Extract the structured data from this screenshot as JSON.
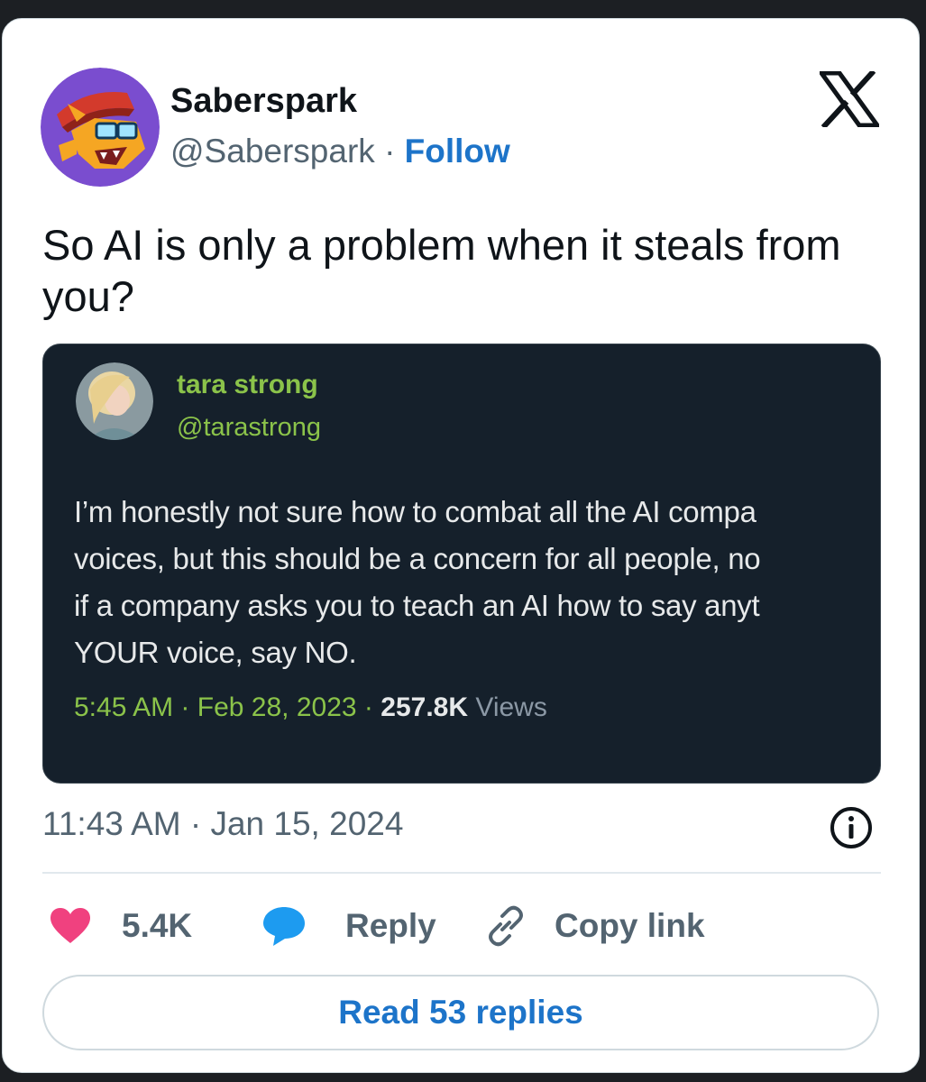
{
  "tweet": {
    "author_name": "Saberspark",
    "author_handle": "@Saberspark",
    "separator": "·",
    "follow_label": "Follow",
    "text": "So AI is only a problem when it steals from you?",
    "timestamp": "11:43 AM · Jan 15, 2024"
  },
  "quoted": {
    "name": "tara strong",
    "handle": "@tarastrong",
    "lines": [
      "I’m honestly not sure how to combat all the AI compa",
      "voices, but this should be a concern for all people, no",
      "if a company asks you to teach an AI how to say anyt",
      "YOUR voice, say NO."
    ],
    "time": "5:45 AM",
    "date": "Feb 28, 2023",
    "sep": "·",
    "views_count": "257.8K",
    "views_label": "Views"
  },
  "actions": {
    "like_count": "5.4K",
    "reply_label": "Reply",
    "copy_link_label": "Copy link",
    "read_replies_label": "Read 53 replies"
  },
  "icons": {
    "logo": "x-logo-icon",
    "info": "info-icon",
    "like": "heart-icon",
    "reply": "speech-bubble-icon",
    "copy": "link-icon"
  },
  "colors": {
    "like": "#f0417f",
    "reply": "#1d9bf0",
    "link": "#1d74c9",
    "quote_accent": "#8bc34a"
  }
}
